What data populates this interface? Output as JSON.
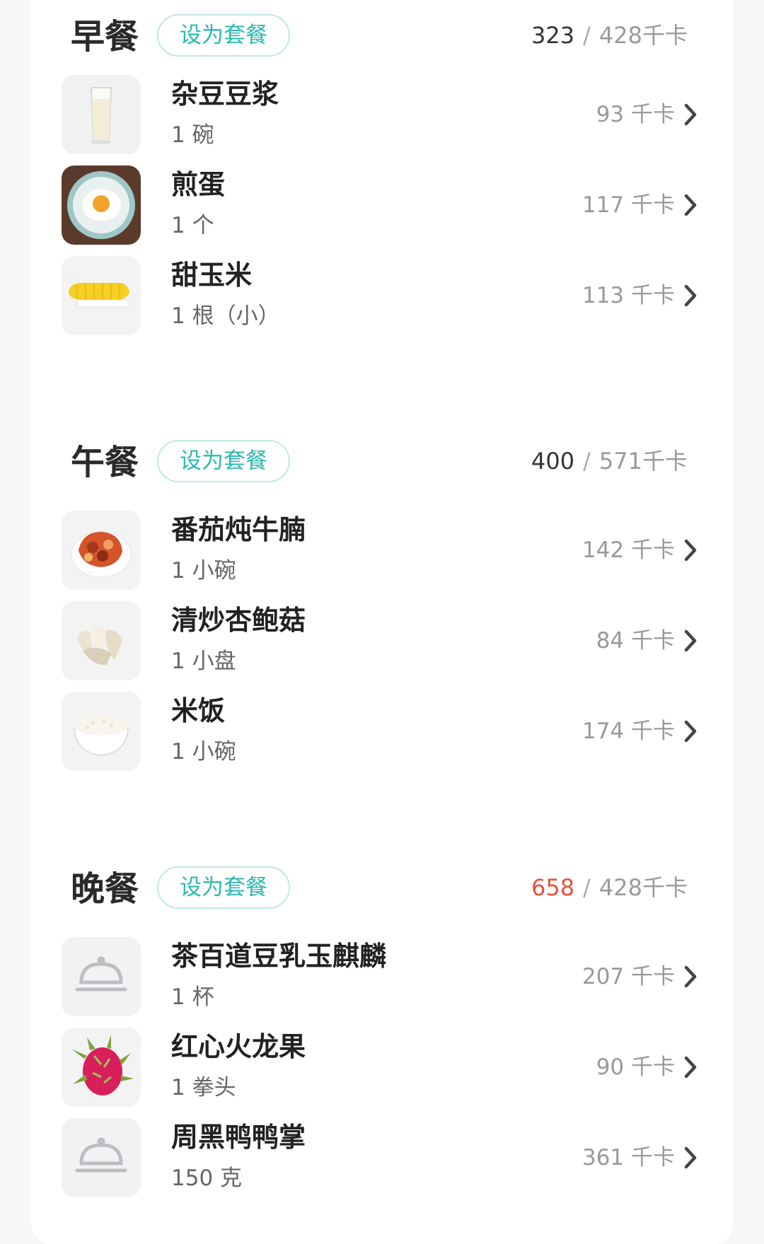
{
  "meals": [
    {
      "title": "早餐",
      "set_label": "设为套餐",
      "current_kcal": "323",
      "separator": "/",
      "target_kcal": "428千卡",
      "over": false,
      "foods": [
        {
          "name": "杂豆豆浆",
          "qty": "1 碗",
          "kcal": "93 千卡",
          "icon": "soy-milk-glass-icon"
        },
        {
          "name": "煎蛋",
          "qty": "1 个",
          "kcal": "117 千卡",
          "icon": "fried-egg-icon"
        },
        {
          "name": "甜玉米",
          "qty": "1 根（小）",
          "kcal": "113 千卡",
          "icon": "corn-icon"
        }
      ]
    },
    {
      "title": "午餐",
      "set_label": "设为套餐",
      "current_kcal": "400",
      "separator": "/",
      "target_kcal": "571千卡",
      "over": false,
      "foods": [
        {
          "name": "番茄炖牛腩",
          "qty": "1 小碗",
          "kcal": "142 千卡",
          "icon": "tomato-beef-stew-icon"
        },
        {
          "name": "清炒杏鲍菇",
          "qty": "1 小盘",
          "kcal": "84 千卡",
          "icon": "mushroom-dish-icon"
        },
        {
          "name": "米饭",
          "qty": "1 小碗",
          "kcal": "174 千卡",
          "icon": "rice-bowl-icon"
        }
      ]
    },
    {
      "title": "晚餐",
      "set_label": "设为套餐",
      "current_kcal": "658",
      "separator": "/",
      "target_kcal": "428千卡",
      "over": true,
      "over_color": "#e5533c",
      "foods": [
        {
          "name": "茶百道豆乳玉麒麟",
          "qty": "1 杯",
          "kcal": "207 千卡",
          "icon": "food-cloche-icon"
        },
        {
          "name": "红心火龙果",
          "qty": "1 拳头",
          "kcal": "90 千卡",
          "icon": "dragon-fruit-icon"
        },
        {
          "name": "周黑鸭鸭掌",
          "qty": "150 克",
          "kcal": "361 千卡",
          "icon": "food-cloche-icon"
        }
      ]
    }
  ],
  "colors": {
    "accent": "#2bb9b0",
    "over": "#e5533c"
  }
}
